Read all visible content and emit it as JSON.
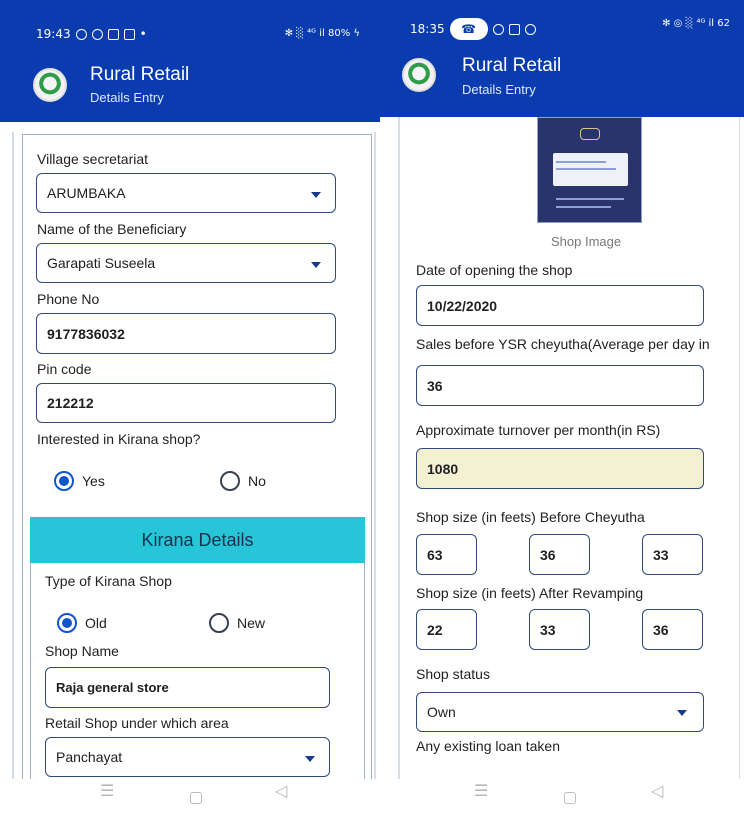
{
  "left_screen": {
    "status": {
      "time": "19:43",
      "battery": "80%",
      "signal": "✻ ░ ⁴ᴳ il"
    },
    "app": {
      "title": "Rural Retail",
      "subtitle": "Details Entry"
    },
    "fields": {
      "village_label": "Village secretariat",
      "village_value": "ARUMBAKA",
      "beneficiary_label": "Name of the Beneficiary",
      "beneficiary_value": "Garapati Suseela",
      "phone_label": "Phone No",
      "phone_value": "9177836032",
      "pin_label": "Pin code",
      "pin_value": "212212",
      "interest_label": "Interested in Kirana shop?",
      "interest_yes": "Yes",
      "interest_no": "No",
      "section_title": "Kirana Details",
      "type_label": "Type of Kirana Shop",
      "type_old": "Old",
      "type_new": "New",
      "shop_name_label": "Shop Name",
      "shop_name_value": "Raja general store",
      "area_label": "Retail Shop under which area",
      "area_value": "Panchayat"
    },
    "navigation": {
      "menu": "☰",
      "home": "",
      "back": "◁"
    }
  },
  "right_screen": {
    "status": {
      "time": "18:35",
      "battery": "62",
      "signal": "✻ ◎ ░ ⁴ᴳ il"
    },
    "app": {
      "title": "Rural Retail",
      "subtitle": "Details Entry"
    },
    "fields": {
      "shop_image_caption": "Shop Image",
      "opening_date_label": "Date of opening the shop",
      "opening_date_value": "10/22/2020",
      "sales_label": "Sales before YSR cheyutha(Average per day in",
      "sales_value": "36",
      "turnover_label": "Approximate turnover per month(in RS)",
      "turnover_value": "1080",
      "size_before_label": "Shop size (in feets) Before Cheyutha",
      "size_before_values": [
        "63",
        "36",
        "33"
      ],
      "size_after_label": "Shop size (in feets) After Revamping",
      "size_after_values": [
        "22",
        "33",
        "36"
      ],
      "status_label": "Shop status",
      "status_value": "Own",
      "loan_label": "Any existing loan taken"
    },
    "navigation": {
      "menu": "☰",
      "home": "",
      "back": "◁"
    }
  },
  "colors": {
    "app_bar": "#0a3cb0",
    "section_banner": "#26c6d8",
    "selected_radio": "#1155cc",
    "readonly_field": "#f4f0d2"
  }
}
